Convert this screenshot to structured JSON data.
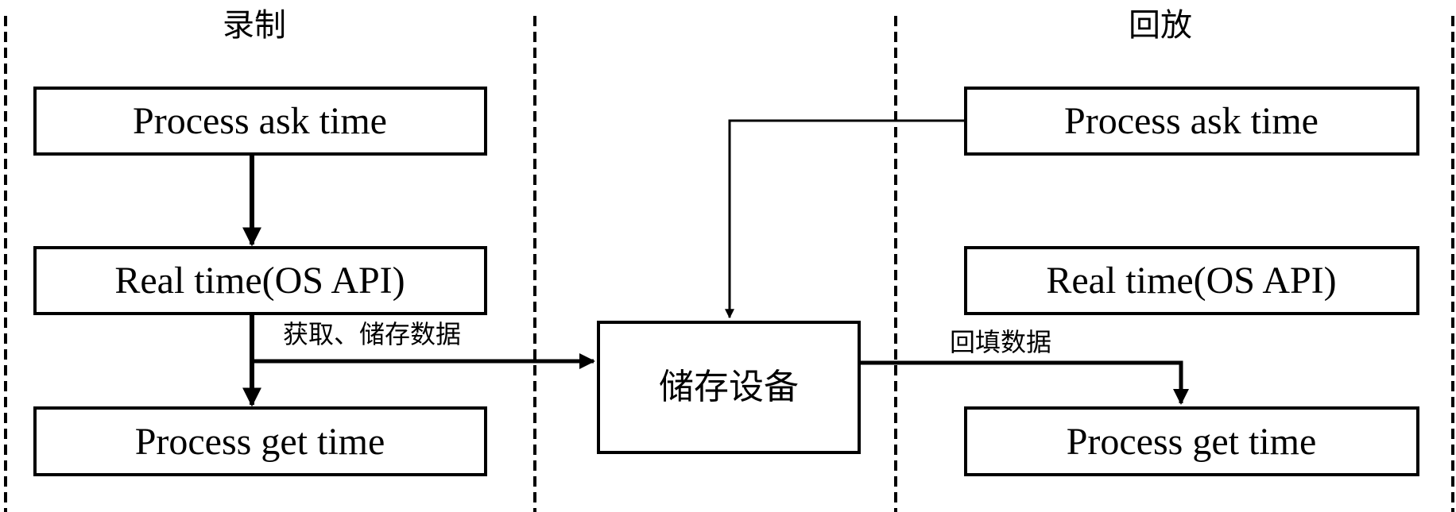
{
  "sections": {
    "record": "录制",
    "playback": "回放"
  },
  "record_boxes": {
    "ask": "Process ask time",
    "real": "Real  time(OS API)",
    "get": "Process get time"
  },
  "playback_boxes": {
    "ask": "Process ask time",
    "real": "Real  time(OS API)",
    "get": "Process get time"
  },
  "storage": "储存设备",
  "edge_labels": {
    "store": "获取、储存数据",
    "fill": "回填数据"
  }
}
